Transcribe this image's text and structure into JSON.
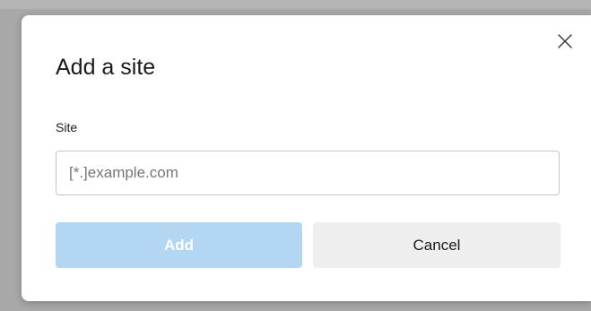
{
  "dialog": {
    "title": "Add a site",
    "close_icon": "close-icon",
    "site_field": {
      "label": "Site",
      "value": "",
      "placeholder": "[*.]example.com"
    },
    "buttons": {
      "add_label": "Add",
      "add_state": "disabled",
      "cancel_label": "Cancel"
    },
    "colors": {
      "add_button_bg": "#b3d6f2",
      "cancel_button_bg": "#eeeeee",
      "backdrop": "#a8a8a8"
    }
  }
}
